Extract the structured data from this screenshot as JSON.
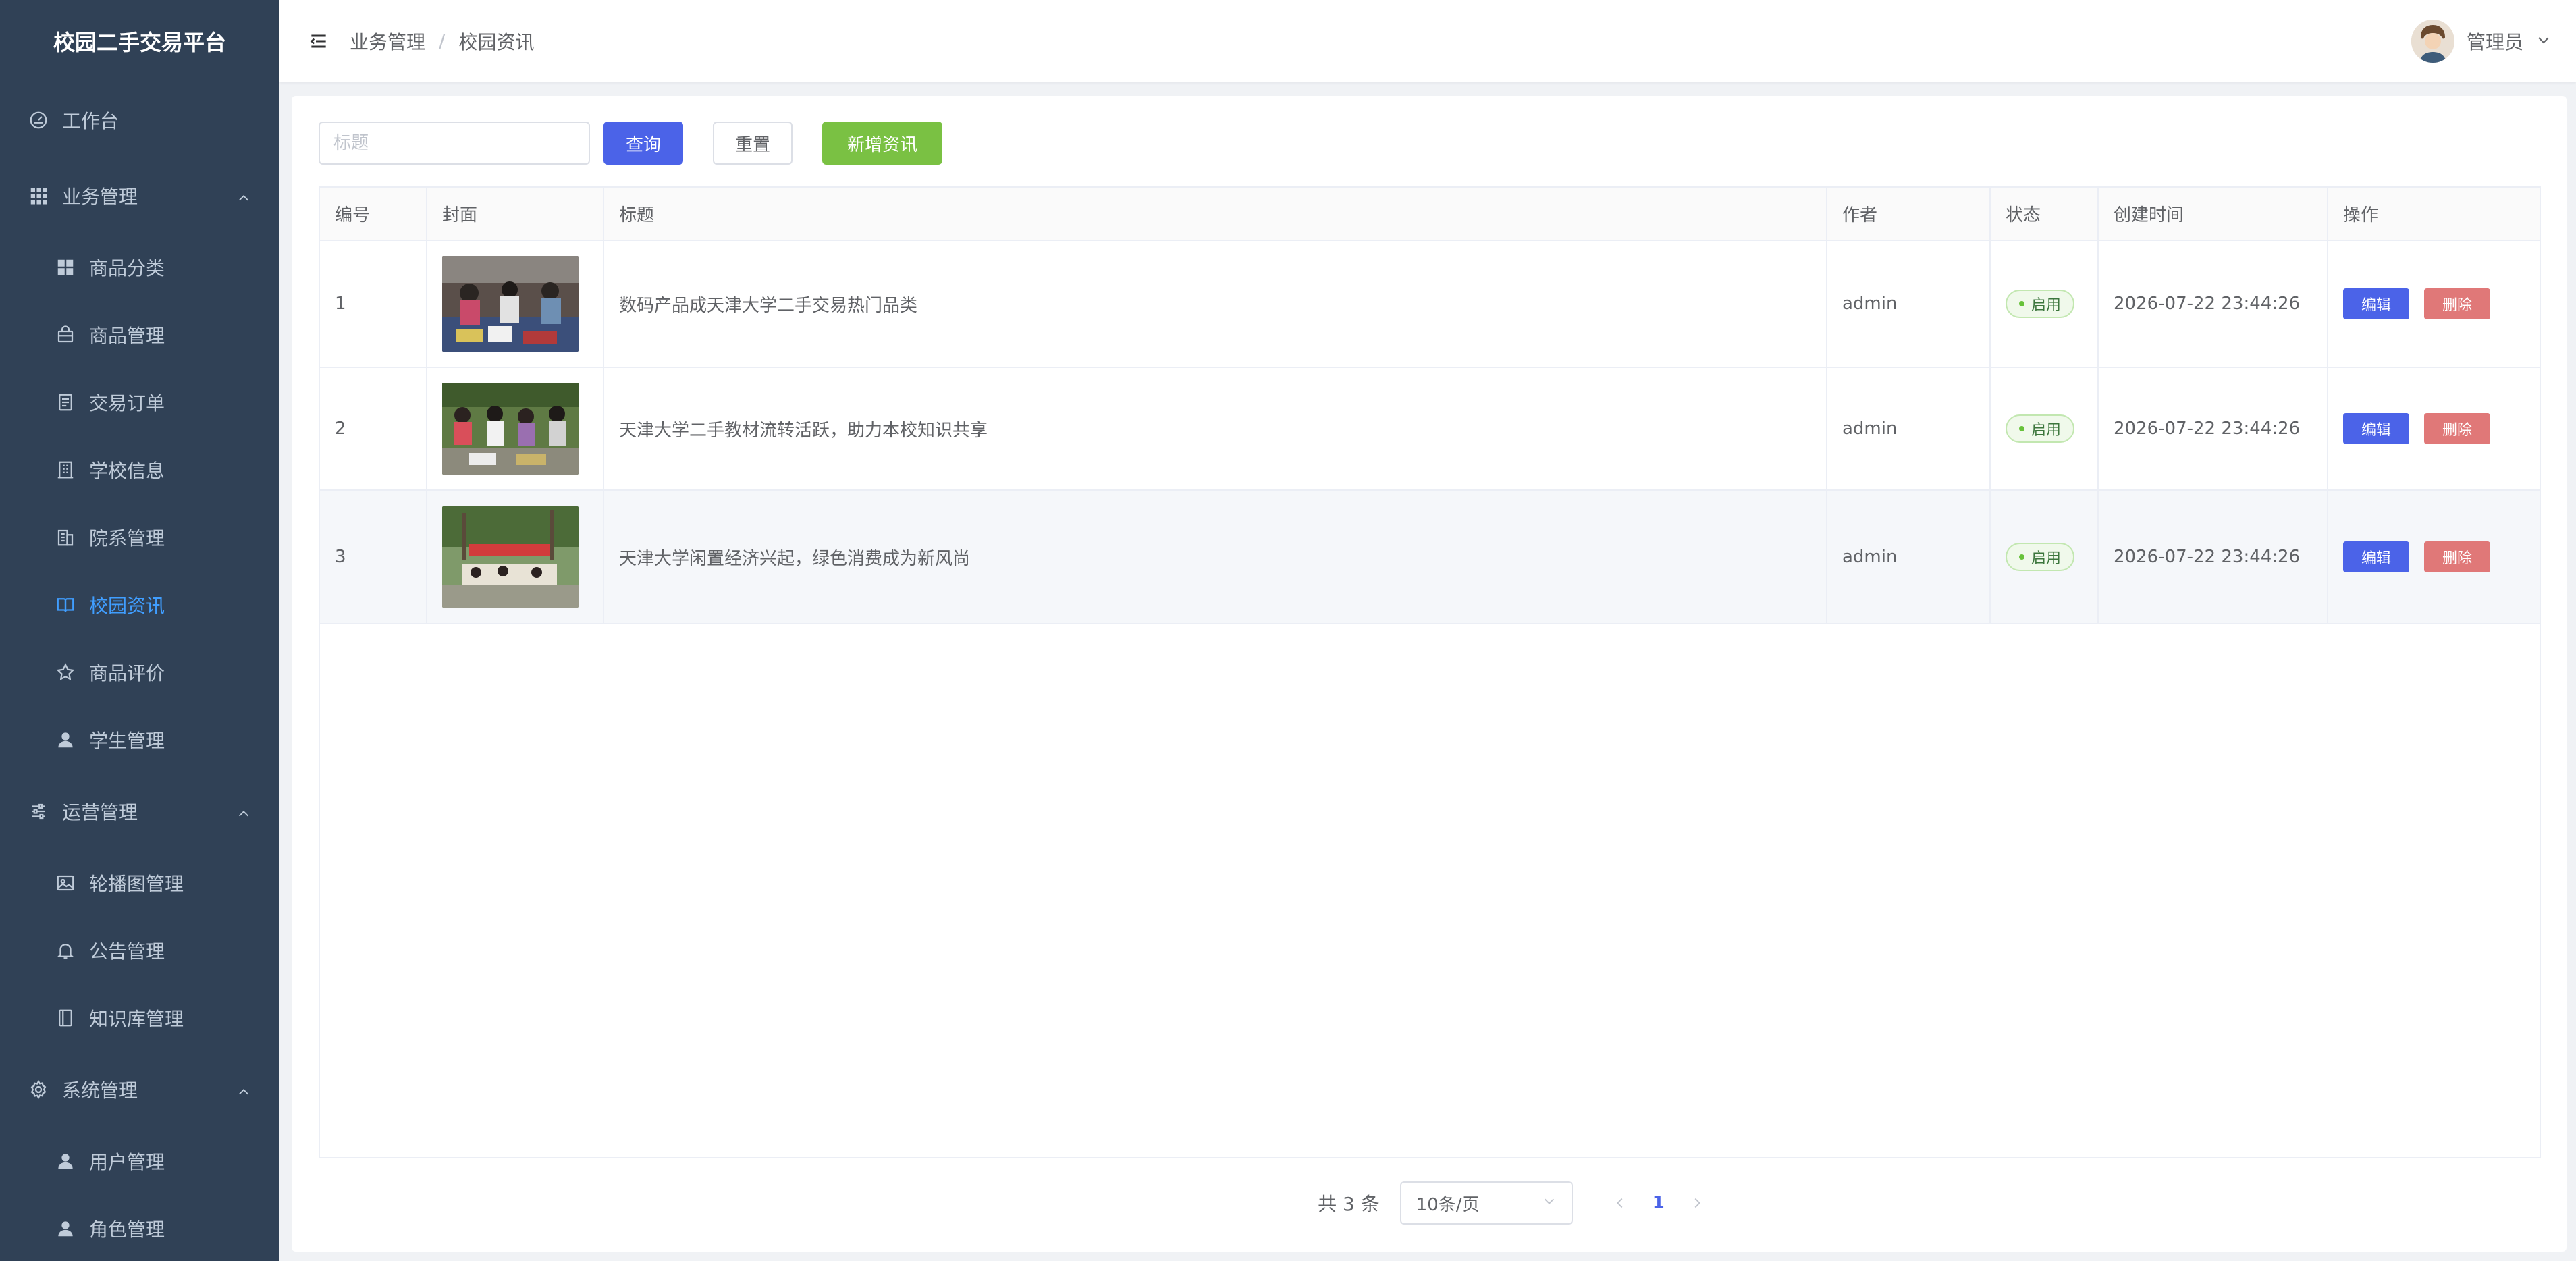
{
  "app": {
    "title": "校园二手交易平台"
  },
  "sidebar": {
    "workbench": {
      "label": "工作台",
      "icon": "dashboard-icon"
    },
    "groups": [
      {
        "label": "业务管理",
        "icon": "grid-icon",
        "expanded": true,
        "items": [
          {
            "label": "商品分类",
            "icon": "category-icon"
          },
          {
            "label": "商品管理",
            "icon": "bag-icon"
          },
          {
            "label": "交易订单",
            "icon": "document-icon"
          },
          {
            "label": "学校信息",
            "icon": "building-icon"
          },
          {
            "label": "院系管理",
            "icon": "office-icon"
          },
          {
            "label": "校园资讯",
            "icon": "book-icon",
            "active": true
          },
          {
            "label": "商品评价",
            "icon": "star-icon"
          },
          {
            "label": "学生管理",
            "icon": "user-icon"
          }
        ]
      },
      {
        "label": "运营管理",
        "icon": "sliders-icon",
        "expanded": true,
        "items": [
          {
            "label": "轮播图管理",
            "icon": "picture-icon"
          },
          {
            "label": "公告管理",
            "icon": "bell-icon"
          },
          {
            "label": "知识库管理",
            "icon": "notebook-icon"
          }
        ]
      },
      {
        "label": "系统管理",
        "icon": "gear-icon",
        "expanded": true,
        "items": [
          {
            "label": "用户管理",
            "icon": "user-icon"
          },
          {
            "label": "角色管理",
            "icon": "user-icon"
          }
        ]
      }
    ],
    "colors": {
      "background": "#304156",
      "text": "#bfcbd9",
      "active": "#409eff"
    }
  },
  "header": {
    "breadcrumb": [
      "业务管理",
      "校园资讯"
    ],
    "separator": "/",
    "user_name": "管理员"
  },
  "toolbar": {
    "search_placeholder": "标题",
    "search_value": "",
    "query_label": "查询",
    "reset_label": "重置",
    "add_label": "新增资讯"
  },
  "table": {
    "columns": [
      "编号",
      "封面",
      "标题",
      "作者",
      "状态",
      "创建时间",
      "操作"
    ],
    "rows": [
      {
        "id": "1",
        "title": "数码产品成天津大学二手交易热门品类",
        "author": "admin",
        "status": "启用",
        "created": "2026-07-22 23:44:26",
        "edit": "编辑",
        "delete": "删除"
      },
      {
        "id": "2",
        "title": "天津大学二手教材流转活跃，助力本校知识共享",
        "author": "admin",
        "status": "启用",
        "created": "2026-07-22 23:44:26",
        "edit": "编辑",
        "delete": "删除"
      },
      {
        "id": "3",
        "title": "天津大学闲置经济兴起，绿色消费成为新风尚",
        "author": "admin",
        "status": "启用",
        "created": "2026-07-22 23:44:26",
        "edit": "编辑",
        "delete": "删除"
      }
    ]
  },
  "pagination": {
    "total_text": "共 3 条",
    "page_size": "10条/页",
    "current_page": "1"
  },
  "colors": {
    "primary": "#4b63e8",
    "success": "#7ac143",
    "danger": "#e07878",
    "tag_green": "#67c23a"
  }
}
